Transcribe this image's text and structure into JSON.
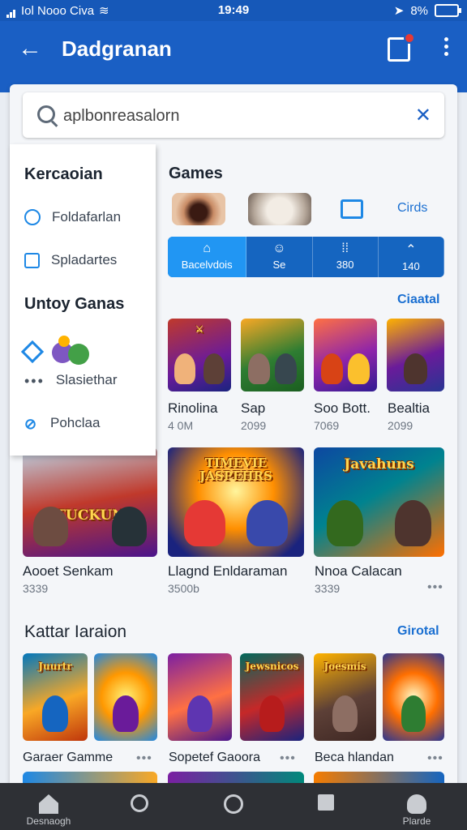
{
  "status": {
    "carrier": "Iol Nooo Civa",
    "time": "19:49",
    "battery": "8%"
  },
  "appbar": {
    "title": "Dadgranan"
  },
  "search": {
    "value": "aplbonreasalorn",
    "clear_label": "✕"
  },
  "drawer": {
    "section1_title": "Kercaoian",
    "items1": [
      {
        "label": "Foldafarlan",
        "icon": "power-icon"
      },
      {
        "label": "Spladartes",
        "icon": "check-square-icon"
      }
    ],
    "section2_title": "Untoy Ganas",
    "items2": [
      {
        "label": "",
        "icon": "diamond-icon"
      },
      {
        "label": "Slasiethar",
        "icon": "dots-icon"
      },
      {
        "label": "Pohclaa",
        "icon": "link-icon"
      }
    ]
  },
  "games_section": {
    "title": "Games",
    "link": "Cirds"
  },
  "tabs": [
    {
      "icon": "⌂",
      "label": "Bacelvdois"
    },
    {
      "icon": "☺",
      "label": "Se"
    },
    {
      "icon": "⁞⁞",
      "label": "380"
    },
    {
      "icon": "⌃",
      "label": "140"
    }
  ],
  "row1": {
    "link": "Ciaatal",
    "items": [
      {
        "name": "Rinolina",
        "sub": "4 0M"
      },
      {
        "name": "Sap",
        "sub": "2099"
      },
      {
        "name": "Soo Bott.",
        "sub": "7069"
      },
      {
        "name": "Bealtia",
        "sub": "2099"
      }
    ]
  },
  "row2": {
    "items": [
      {
        "name": "Aooet Senkam",
        "sub": "3339",
        "logo": "TUCKUN"
      },
      {
        "name": "Llagnd Enldaraman",
        "sub": "3500b",
        "logo": "TIMEVIE JASPEHRS"
      },
      {
        "name": "Nnoa Calacan",
        "sub": "3339",
        "logo": "Javahuns"
      }
    ]
  },
  "row3": {
    "title": "Kattar Iaraion",
    "link": "Girotal",
    "items": [
      {
        "name": "Garaer Gamme",
        "logo": "Juurtr"
      },
      {
        "name": "Sopetef Gaoora",
        "logo": "Jewsnicos"
      },
      {
        "name": "Beca hlandan",
        "logo": "Joesmis"
      }
    ],
    "more": "•••"
  },
  "navbar": [
    {
      "label": "Desnaogh",
      "icon": "home-icon"
    },
    {
      "label": "",
      "icon": "search-icon"
    },
    {
      "label": "",
      "icon": "compass-icon"
    },
    {
      "label": "",
      "icon": "square-icon"
    },
    {
      "label": "Plarde",
      "icon": "profile-icon"
    }
  ],
  "colors": {
    "primary": "#1a5fc4",
    "accent": "#2196f3",
    "nav": "#2e3035"
  }
}
